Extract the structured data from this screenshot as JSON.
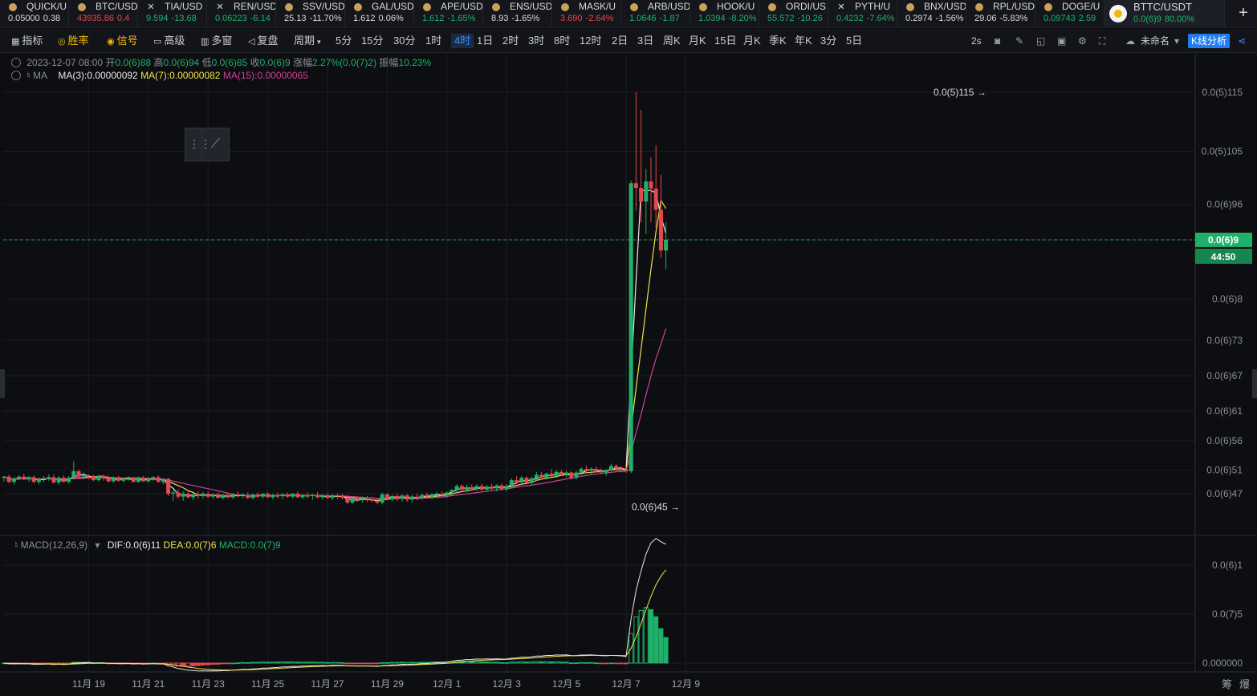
{
  "tickers": [
    {
      "symbol": "QUICK/U",
      "price": "0.05000",
      "change": "0.38",
      "dir": "wh",
      "icon": "coin-icon"
    },
    {
      "symbol": "BTC/USD",
      "price": "43935.86",
      "change": "0.4",
      "dir": "dn",
      "icon": "coin-icon"
    },
    {
      "symbol": "TIA/USD",
      "price": "9.594",
      "change": "-13.68",
      "dir": "up",
      "icon": "x-icon"
    },
    {
      "symbol": "REN/USD",
      "price": "0.06223",
      "change": "-6.14",
      "dir": "up",
      "icon": "x-icon"
    },
    {
      "symbol": "SSV/USD",
      "price": "25.13",
      "change": "-11.70%",
      "dir": "wh",
      "icon": "coin-icon"
    },
    {
      "symbol": "GAL/USD",
      "price": "1.612",
      "change": "0.06%",
      "dir": "wh",
      "icon": "coin-icon"
    },
    {
      "symbol": "APE/USD",
      "price": "1.612",
      "change": "-1.65%",
      "dir": "up",
      "icon": "coin-icon"
    },
    {
      "symbol": "ENS/USD",
      "price": "8.93",
      "change": "-1.65%",
      "dir": "wh",
      "icon": "coin-icon"
    },
    {
      "symbol": "MASK/U",
      "price": "3.690",
      "change": "-2.64%",
      "dir": "dn",
      "icon": "coin-icon"
    },
    {
      "symbol": "ARB/USD",
      "price": "1.0646",
      "change": "-1.87",
      "dir": "up",
      "icon": "coin-icon"
    },
    {
      "symbol": "HOOK/U",
      "price": "1.0394",
      "change": "-8.20%",
      "dir": "up",
      "icon": "coin-icon"
    },
    {
      "symbol": "ORDI/US",
      "price": "55.572",
      "change": "-10.26",
      "dir": "up",
      "icon": "coin-icon"
    },
    {
      "symbol": "PYTH/U",
      "price": "0.4232",
      "change": "-7.64%",
      "dir": "up",
      "icon": "x-icon"
    },
    {
      "symbol": "BNX/USD",
      "price": "0.2974",
      "change": "-1.56%",
      "dir": "wh",
      "icon": "coin-icon"
    },
    {
      "symbol": "RPL/USD",
      "price": "29.06",
      "change": "-5.83%",
      "dir": "wh",
      "icon": "coin-icon"
    },
    {
      "symbol": "DOGE/U",
      "price": "0.09743",
      "change": "2.59",
      "dir": "up",
      "icon": "coin-icon"
    }
  ],
  "active_ticker": {
    "symbol": "BTTC/USDT",
    "price": "0.0(6)9",
    "change": "80.00%"
  },
  "toolbar": {
    "left": [
      "指标",
      "胜率",
      "信号",
      "高级",
      "多窗",
      "复盘",
      "周期"
    ],
    "intervals": [
      "5分",
      "15分",
      "30分",
      "1时",
      "4时",
      "1日",
      "2时",
      "3时",
      "8时",
      "12时",
      "2日",
      "3日",
      "周K",
      "月K",
      "15日",
      "月K",
      "季K",
      "年K",
      "3分",
      "5日"
    ],
    "active_interval": "4时",
    "refresh": "2s",
    "layout_name": "未命名",
    "kline_button": "K线分析"
  },
  "legend": {
    "date": "2023-12-07 08:00",
    "open_label": "开",
    "open": "0.0(6)88",
    "high_label": "高",
    "high": "0.0(6)94",
    "low_label": "低",
    "low": "0.0(6)85",
    "close_label": "收",
    "close": "0.0(6)9",
    "chg_label": "涨幅",
    "chg": "2.27%(0.0(7)2)",
    "amp_label": "振幅",
    "amp": "10.23%",
    "ma_label": "MA",
    "ma3": "MA(3):0.00000092",
    "ma7": "MA(7):0.00000082",
    "ma15": "MA(15):0.00000065",
    "macd_label": "MACD(12,26,9)",
    "dif": "DIF:0.0(6)11",
    "dea": "DEA:0.0(7)6",
    "macd": "MACD:0.0(7)9"
  },
  "annotations": {
    "high_mark": "0.0(5)115 →",
    "low_mark": "0.0(6)45 →"
  },
  "last_price_tag": {
    "price": "0.0(6)9",
    "countdown": "44:50"
  },
  "colors": {
    "up": "#1fb16a",
    "down": "#e5484d",
    "ma3": "#e8e8e8",
    "ma7": "#f1e34a",
    "ma15": "#d0409a",
    "accent": "#1f7cf2"
  },
  "chart_data": {
    "type": "candlestick",
    "interval": "4时",
    "y_ticks": [
      "0.0(5)115",
      "0.0(5)105",
      "0.0(6)96",
      "0.0(6)9",
      "0.0(6)8",
      "0.0(6)73",
      "0.0(6)67",
      "0.0(6)61",
      "0.0(6)56",
      "0.0(6)51",
      "0.0(6)47"
    ],
    "y_tick_values": [
      1.15,
      1.05,
      0.96,
      0.9,
      0.8,
      0.73,
      0.67,
      0.61,
      0.56,
      0.51,
      0.47
    ],
    "y_unit_multiplier": "1e-6",
    "ylim": [
      0.42,
      1.22
    ],
    "x_ticks": [
      "11月 19",
      "11月 21",
      "11月 23",
      "11月 25",
      "11月 27",
      "11月 29",
      "12月 1",
      "12月 3",
      "12月 5",
      "12月 7",
      "12月 9"
    ],
    "x_tick_index": [
      17,
      29,
      41,
      53,
      65,
      77,
      89,
      101,
      113,
      125,
      137
    ],
    "macd_y_ticks": [
      "0.0(6)1",
      "0.0(7)5",
      "0.000000"
    ],
    "macd_y_tick_values": [
      0.1,
      0.05,
      0
    ],
    "candles": [
      [
        0.497,
        0.5,
        0.491,
        0.499
      ],
      [
        0.499,
        0.502,
        0.488,
        0.49
      ],
      [
        0.49,
        0.498,
        0.486,
        0.496
      ],
      [
        0.496,
        0.501,
        0.493,
        0.499
      ],
      [
        0.499,
        0.504,
        0.493,
        0.494
      ],
      [
        0.494,
        0.5,
        0.49,
        0.498
      ],
      [
        0.498,
        0.501,
        0.488,
        0.49
      ],
      [
        0.49,
        0.497,
        0.486,
        0.495
      ],
      [
        0.495,
        0.5,
        0.49,
        0.496
      ],
      [
        0.496,
        0.503,
        0.492,
        0.498
      ],
      [
        0.498,
        0.503,
        0.487,
        0.489
      ],
      [
        0.489,
        0.5,
        0.485,
        0.497
      ],
      [
        0.497,
        0.501,
        0.489,
        0.49
      ],
      [
        0.49,
        0.5,
        0.487,
        0.497
      ],
      [
        0.497,
        0.525,
        0.494,
        0.508
      ],
      [
        0.508,
        0.511,
        0.496,
        0.499
      ],
      [
        0.499,
        0.506,
        0.494,
        0.501
      ],
      [
        0.501,
        0.503,
        0.495,
        0.5
      ],
      [
        0.5,
        0.502,
        0.491,
        0.493
      ],
      [
        0.493,
        0.502,
        0.49,
        0.5
      ],
      [
        0.5,
        0.502,
        0.492,
        0.497
      ],
      [
        0.497,
        0.501,
        0.489,
        0.491
      ],
      [
        0.491,
        0.499,
        0.489,
        0.498
      ],
      [
        0.498,
        0.5,
        0.49,
        0.492
      ],
      [
        0.492,
        0.498,
        0.489,
        0.496
      ],
      [
        0.496,
        0.5,
        0.492,
        0.497
      ],
      [
        0.497,
        0.499,
        0.489,
        0.49
      ],
      [
        0.49,
        0.499,
        0.489,
        0.497
      ],
      [
        0.497,
        0.5,
        0.49,
        0.491
      ],
      [
        0.491,
        0.498,
        0.489,
        0.496
      ],
      [
        0.496,
        0.5,
        0.492,
        0.498
      ],
      [
        0.498,
        0.501,
        0.489,
        0.49
      ],
      [
        0.49,
        0.496,
        0.486,
        0.495
      ],
      [
        0.495,
        0.497,
        0.466,
        0.47
      ],
      [
        0.47,
        0.476,
        0.458,
        0.472
      ],
      [
        0.472,
        0.478,
        0.461,
        0.465
      ],
      [
        0.465,
        0.474,
        0.458,
        0.47
      ],
      [
        0.47,
        0.475,
        0.462,
        0.464
      ],
      [
        0.464,
        0.471,
        0.459,
        0.469
      ],
      [
        0.469,
        0.474,
        0.461,
        0.466
      ],
      [
        0.466,
        0.473,
        0.462,
        0.47
      ],
      [
        0.47,
        0.474,
        0.463,
        0.465
      ],
      [
        0.465,
        0.471,
        0.461,
        0.469
      ],
      [
        0.469,
        0.472,
        0.462,
        0.463
      ],
      [
        0.463,
        0.47,
        0.46,
        0.468
      ],
      [
        0.468,
        0.472,
        0.462,
        0.464
      ],
      [
        0.464,
        0.471,
        0.461,
        0.469
      ],
      [
        0.469,
        0.474,
        0.464,
        0.467
      ],
      [
        0.467,
        0.471,
        0.462,
        0.468
      ],
      [
        0.468,
        0.473,
        0.461,
        0.463
      ],
      [
        0.463,
        0.47,
        0.46,
        0.469
      ],
      [
        0.469,
        0.472,
        0.463,
        0.465
      ],
      [
        0.465,
        0.471,
        0.462,
        0.47
      ],
      [
        0.47,
        0.473,
        0.463,
        0.464
      ],
      [
        0.464,
        0.47,
        0.461,
        0.468
      ],
      [
        0.468,
        0.472,
        0.462,
        0.466
      ],
      [
        0.466,
        0.471,
        0.461,
        0.469
      ],
      [
        0.469,
        0.472,
        0.463,
        0.465
      ],
      [
        0.465,
        0.471,
        0.462,
        0.47
      ],
      [
        0.47,
        0.474,
        0.463,
        0.464
      ],
      [
        0.464,
        0.47,
        0.461,
        0.468
      ],
      [
        0.468,
        0.472,
        0.462,
        0.466
      ],
      [
        0.466,
        0.47,
        0.46,
        0.468
      ],
      [
        0.468,
        0.473,
        0.462,
        0.464
      ],
      [
        0.464,
        0.469,
        0.46,
        0.467
      ],
      [
        0.467,
        0.471,
        0.461,
        0.463
      ],
      [
        0.463,
        0.469,
        0.459,
        0.467
      ],
      [
        0.467,
        0.471,
        0.461,
        0.466
      ],
      [
        0.466,
        0.47,
        0.46,
        0.463
      ],
      [
        0.463,
        0.468,
        0.452,
        0.455
      ],
      [
        0.455,
        0.464,
        0.452,
        0.462
      ],
      [
        0.462,
        0.466,
        0.456,
        0.459
      ],
      [
        0.459,
        0.465,
        0.455,
        0.461
      ],
      [
        0.461,
        0.466,
        0.456,
        0.46
      ],
      [
        0.46,
        0.464,
        0.455,
        0.458
      ],
      [
        0.458,
        0.463,
        0.452,
        0.455
      ],
      [
        0.455,
        0.472,
        0.452,
        0.469
      ],
      [
        0.469,
        0.471,
        0.459,
        0.461
      ],
      [
        0.461,
        0.468,
        0.457,
        0.466
      ],
      [
        0.466,
        0.47,
        0.458,
        0.462
      ],
      [
        0.462,
        0.469,
        0.457,
        0.467
      ],
      [
        0.467,
        0.47,
        0.456,
        0.46
      ],
      [
        0.46,
        0.468,
        0.455,
        0.465
      ],
      [
        0.465,
        0.47,
        0.459,
        0.463
      ],
      [
        0.463,
        0.47,
        0.46,
        0.468
      ],
      [
        0.468,
        0.472,
        0.462,
        0.465
      ],
      [
        0.465,
        0.471,
        0.461,
        0.469
      ],
      [
        0.469,
        0.473,
        0.463,
        0.47
      ],
      [
        0.47,
        0.474,
        0.464,
        0.468
      ],
      [
        0.468,
        0.474,
        0.463,
        0.472
      ],
      [
        0.472,
        0.478,
        0.467,
        0.476
      ],
      [
        0.476,
        0.486,
        0.47,
        0.483
      ],
      [
        0.483,
        0.486,
        0.474,
        0.477
      ],
      [
        0.477,
        0.485,
        0.472,
        0.481
      ],
      [
        0.481,
        0.486,
        0.475,
        0.478
      ],
      [
        0.478,
        0.486,
        0.474,
        0.483
      ],
      [
        0.483,
        0.487,
        0.475,
        0.477
      ],
      [
        0.477,
        0.485,
        0.473,
        0.482
      ],
      [
        0.482,
        0.487,
        0.476,
        0.479
      ],
      [
        0.479,
        0.486,
        0.474,
        0.484
      ],
      [
        0.484,
        0.488,
        0.476,
        0.478
      ],
      [
        0.478,
        0.486,
        0.474,
        0.483
      ],
      [
        0.483,
        0.496,
        0.479,
        0.493
      ],
      [
        0.493,
        0.5,
        0.486,
        0.489
      ],
      [
        0.489,
        0.5,
        0.486,
        0.497
      ],
      [
        0.497,
        0.5,
        0.486,
        0.488
      ],
      [
        0.488,
        0.499,
        0.485,
        0.496
      ],
      [
        0.496,
        0.507,
        0.492,
        0.502
      ],
      [
        0.502,
        0.507,
        0.494,
        0.497
      ],
      [
        0.497,
        0.506,
        0.494,
        0.504
      ],
      [
        0.504,
        0.512,
        0.498,
        0.5
      ],
      [
        0.5,
        0.51,
        0.497,
        0.507
      ],
      [
        0.507,
        0.51,
        0.5,
        0.502
      ],
      [
        0.502,
        0.509,
        0.498,
        0.506
      ],
      [
        0.506,
        0.508,
        0.494,
        0.497
      ],
      [
        0.497,
        0.509,
        0.494,
        0.506
      ],
      [
        0.506,
        0.515,
        0.502,
        0.512
      ],
      [
        0.512,
        0.518,
        0.506,
        0.509
      ],
      [
        0.509,
        0.515,
        0.503,
        0.512
      ],
      [
        0.512,
        0.516,
        0.505,
        0.508
      ],
      [
        0.508,
        0.513,
        0.503,
        0.506
      ],
      [
        0.506,
        0.512,
        0.5,
        0.51
      ],
      [
        0.51,
        0.521,
        0.507,
        0.517
      ],
      [
        0.517,
        0.52,
        0.509,
        0.513
      ],
      [
        0.513,
        0.516,
        0.506,
        0.511
      ],
      [
        0.511,
        0.512,
        0.505,
        0.508
      ],
      [
        0.508,
        1.0,
        0.505,
        0.996
      ],
      [
        0.996,
        1.15,
        0.95,
        0.988
      ],
      [
        0.988,
        1.12,
        0.93,
        0.965
      ],
      [
        0.965,
        1.02,
        0.91,
        0.999
      ],
      [
        0.999,
        1.04,
        0.93,
        0.987
      ],
      [
        0.987,
        1.06,
        0.92,
        0.951
      ],
      [
        0.951,
        1.01,
        0.87,
        0.882
      ],
      [
        0.882,
        0.93,
        0.85,
        0.9
      ]
    ],
    "ma_series": [
      {
        "name": "MA(3)",
        "color": "#e8e8e8"
      },
      {
        "name": "MA(7)",
        "color": "#f1e34a"
      },
      {
        "name": "MA(15)",
        "color": "#d0409a"
      }
    ]
  }
}
